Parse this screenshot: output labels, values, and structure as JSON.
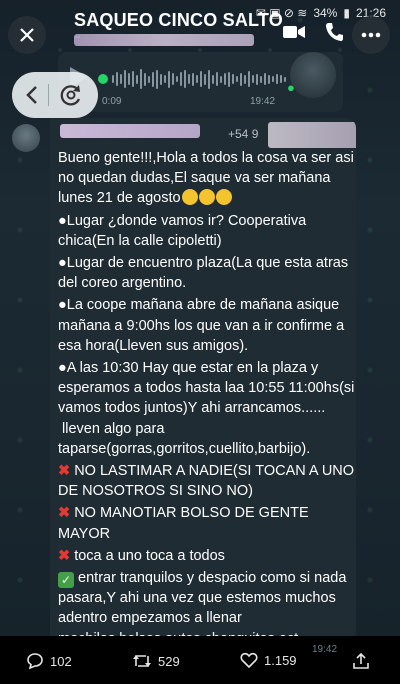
{
  "status_bar": {
    "battery": "34%",
    "clock": "21:26"
  },
  "header": {
    "title": "SAQUEO CINCO SALTO"
  },
  "voice_message": {
    "duration": "0:09",
    "time": "19:42"
  },
  "message": {
    "phone_prefix": "+54 9",
    "lines": [
      "Bueno gente!!!,Hola a todos la cosa va ser asi no quedan dudas,El saque va ser mañana lunes 21 de agosto",
      "●Lugar ¿donde vamos ir? Cooperativa chica(En la calle cipoletti)",
      "●Lugar de encuentro plaza(La que esta atras del coreo argentino.",
      "●La coope mañana abre de mañana asique mañana a 9:00hs los que van a ir confirme a esa hora(Lleven sus amigos).",
      "●A las 10:30 Hay que estar en la plaza y esperamos a todos hasta laa 10:55 11:00hs(si vamos todos juntos)Y ahi arrancamos......\n lleven algo para taparse(gorras,gorritos,cuellito,barbijo).",
      "NO LASTIMAR A NADIE(SI TOCAN A UNO DE NOSOTROS SI SINO NO)",
      "NO MANOTIAR BOLSO DE GENTE MAYOR",
      "toca a uno toca a todos",
      "entrar tranquilos y despacio como si nada pasara,Y ahi una vez que estemos muchos adentro empezamos a llenar mochilas,bolsos,autos,changuitos ect."
    ]
  },
  "engagement": {
    "comments": "102",
    "reposts": "529",
    "likes": "1.159",
    "time": "19:42"
  },
  "colors": {
    "accent": "#25d366",
    "bubble": "#1f2c33",
    "x_mark": "#e53935",
    "check": "#43a047"
  },
  "icons": [
    "close-icon",
    "more-icon",
    "video-call-icon",
    "phone-icon",
    "play-icon",
    "mic-icon",
    "back-icon",
    "rotate-icon",
    "comment-icon",
    "repost-icon",
    "heart-icon",
    "share-icon"
  ]
}
